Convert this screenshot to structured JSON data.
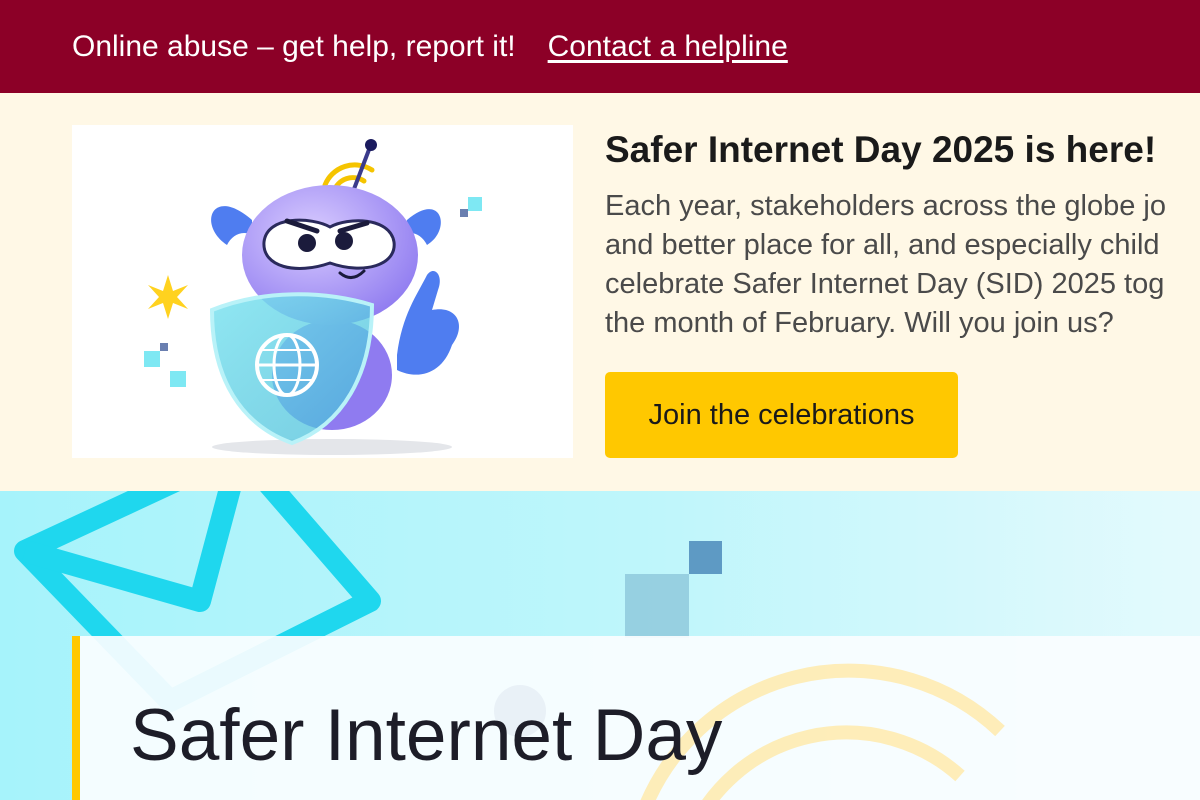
{
  "alert_bar": {
    "text": "Online abuse – get help, report it!",
    "link_label": "Contact a helpline"
  },
  "promo": {
    "title": "Safer Internet Day 2025 is here!",
    "body_lines": [
      "Each year, stakeholders across the globe jo",
      "and better place for all, and especially child",
      "celebrate Safer Internet Day (SID) 2025 tog",
      "the month of February. Will you join us?"
    ],
    "cta_label": "Join the celebrations",
    "illustration": "robot-mascot-with-shield-illustration"
  },
  "hero": {
    "title": "Safer Internet Day",
    "background_icons": [
      "envelope-icon",
      "pixel-squares",
      "wifi-icon"
    ]
  },
  "colors": {
    "alert_bg": "#8c0027",
    "promo_bg": "#fff8e6",
    "cta_bg": "#ffc800",
    "hero_accent": "#ffc800",
    "hero_bg": "#a6f3fb"
  }
}
